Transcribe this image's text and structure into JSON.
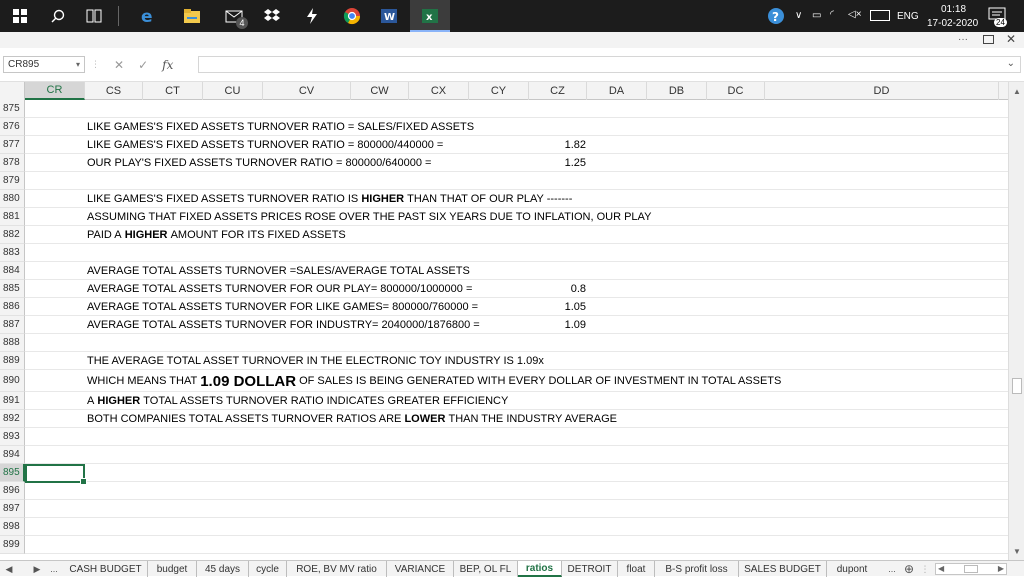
{
  "taskbar": {
    "badge_count": "4",
    "tray": {
      "language": "ENG",
      "time": "01:18",
      "date": "17-02-2020",
      "notifications": "24"
    }
  },
  "formula_bar": {
    "name_box": "CR895",
    "fx": "fx",
    "formula": ""
  },
  "columns": [
    "CR",
    "CS",
    "CT",
    "CU",
    "CV",
    "CW",
    "CX",
    "CY",
    "CZ",
    "DA",
    "DB",
    "DC",
    "DD"
  ],
  "selected_column": "CR",
  "rows": [
    "875",
    "876",
    "877",
    "878",
    "879",
    "880",
    "881",
    "882",
    "883",
    "884",
    "885",
    "886",
    "887",
    "888",
    "889",
    "890",
    "891",
    "892",
    "893",
    "894",
    "895",
    "896",
    "897",
    "898",
    "899"
  ],
  "selected_row": "895",
  "cells": {
    "r876": "LIKE GAMES'S FIXED ASSETS TURNOVER RATIO = SALES/FIXED ASSETS",
    "r877": "LIKE GAMES'S FIXED ASSETS TURNOVER RATIO = 800000/440000 =",
    "r877_val": "1.82",
    "r878": "OUR PLAY'S FIXED ASSETS TURNOVER RATIO = 800000/640000 =",
    "r878_val": "1.25",
    "r880_a": "LIKE GAMES'S FIXED ASSETS TURNOVER RATIO IS",
    "r880_b": "HIGHER",
    "r880_c": "THAN THAT OF OUR PLAY -------",
    "r881": "ASSUMING THAT FIXED ASSETS PRICES ROSE OVER THE PAST SIX YEARS DUE TO INFLATION, OUR PLAY",
    "r882_a": "PAID A",
    "r882_b": "HIGHER",
    "r882_c": "AMOUNT FOR ITS FIXED ASSETS",
    "r884": "AVERAGE TOTAL ASSETS TURNOVER =SALES/AVERAGE TOTAL ASSETS",
    "r885": "AVERAGE TOTAL ASSETS TURNOVER FOR OUR PLAY= 800000/1000000 =",
    "r885_val": "0.8",
    "r886": "AVERAGE TOTAL ASSETS TURNOVER FOR LIKE GAMES= 800000/760000 =",
    "r886_val": "1.05",
    "r887": "AVERAGE TOTAL ASSETS TURNOVER FOR INDUSTRY= 2040000/1876800 =",
    "r887_val": "1.09",
    "r889": "THE AVERAGE TOTAL ASSET TURNOVER IN THE ELECTRONIC TOY INDUSTRY IS 1.09x",
    "r890_a": "WHICH MEANS THAT",
    "r890_b": "1.09 DOLLAR",
    "r890_c": "OF SALES IS BEING GENERATED WITH EVERY DOLLAR OF INVESTMENT IN TOTAL ASSETS",
    "r891_a": "A",
    "r891_b": "HIGHER",
    "r891_c": "TOTAL ASSETS TURNOVER RATIO INDICATES GREATER EFFICIENCY",
    "r892_a": "BOTH COMPANIES TOTAL ASSETS TURNOVER RATIOS ARE",
    "r892_b": "LOWER",
    "r892_c": "THAN THE INDUSTRY AVERAGE"
  },
  "sheet_tabs": [
    "CASH BUDGET",
    "budget",
    "45 days",
    "cycle",
    "ROE, BV MV ratio",
    "VARIANCE",
    "BEP, OL FL",
    "ratios",
    "DETROIT",
    "float",
    "B-S profit loss",
    "SALES BUDGET",
    "dupont"
  ],
  "active_sheet": "ratios",
  "sheet_nav": {
    "prev": "◀",
    "next": "▶",
    "more_left": "...",
    "more_right": "...",
    "add": "⊕"
  },
  "colors": {
    "excel_green": "#217346",
    "taskbar": "#1c1c1c"
  }
}
